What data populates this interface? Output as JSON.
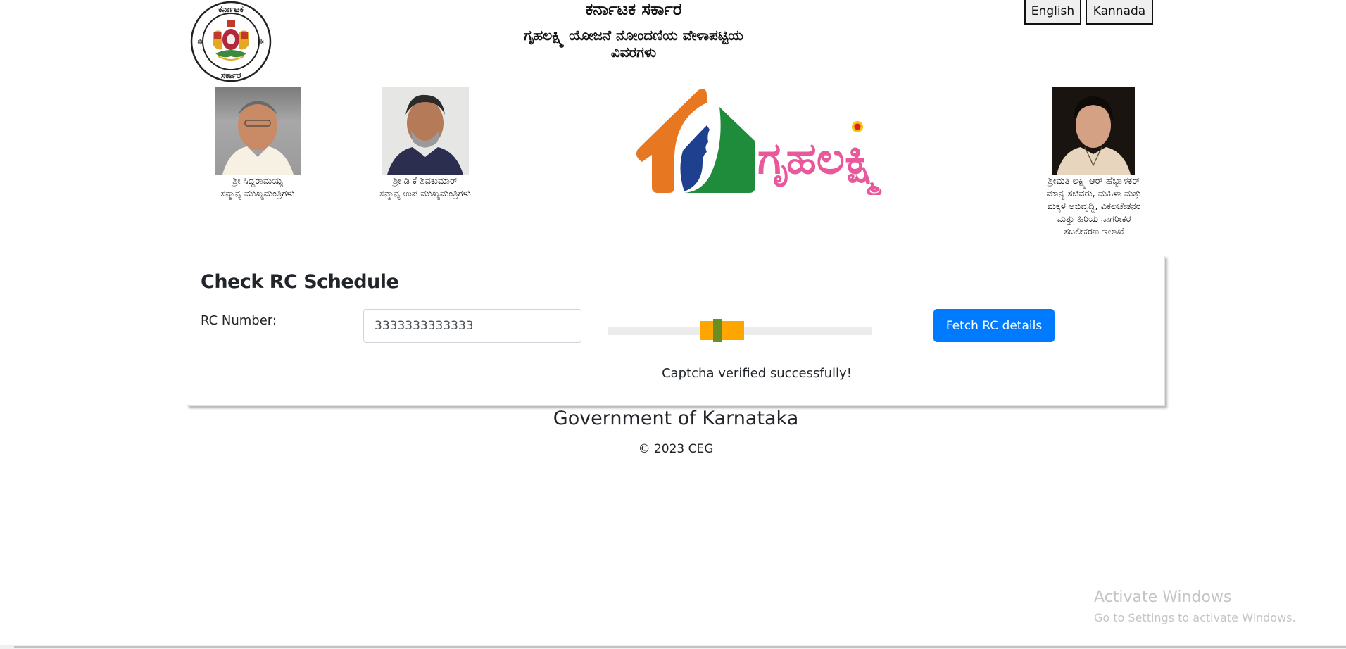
{
  "header": {
    "title": "ಕರ್ನಾಟಕ ಸರ್ಕಾರ",
    "subtitle_line1": "ಗೃಹಲಕ್ಷ್ಮಿ ಯೋಜನೆ ನೋಂದಣಿಯ ವೇಳಾಪಟ್ಟಿಯ",
    "subtitle_line2": "ವಿವರಗಳು",
    "emblem_text_top": "ಕರ್ನಾಟಕ",
    "emblem_text_bottom": "ಸರ್ಕಾರ",
    "language_buttons": [
      "English",
      "Kannada"
    ]
  },
  "leaders": [
    {
      "name": "ಶ್ರೀ ಸಿದ್ದರಾಮಯ್ಯ",
      "title_lines": [
        "ಸನ್ಮಾನ್ಯ ಮುಖ್ಯಮಂತ್ರಿಗಳು"
      ]
    },
    {
      "name": "ಶ್ರೀ ಡಿ ಕೆ ಶಿವಕುಮಾರ್",
      "title_lines": [
        "ಸನ್ಮಾನ್ಯ ಉಪ ಮುಖ್ಯಮಂತ್ರಿಗಳು"
      ]
    },
    {
      "name": "ಶ್ರೀಮತಿ ಲಕ್ಷ್ಮಿ ಆರ್ ಹೆಬ್ಬಾಳಕರ್",
      "title_lines": [
        "ಮಾನ್ಯ ಸಚಿವರು, ಮಹಿಳಾ ಮತ್ತು",
        "ಮಕ್ಕಳ ಅಭಿವೃದ್ಧಿ, ವಿಕಲಚೇತನರ",
        "ಮತ್ತು ಹಿರಿಯ ನಾಗರೀಕರ",
        "ಸಬಲೀಕರಣ ಇಲಾಖೆ"
      ]
    }
  ],
  "logo": {
    "text": "ಗೃಹಲಕ್ಷ್ಮಿ",
    "colors": {
      "orange": "#e87722",
      "green": "#1e8c3a",
      "blue": "#1f3f8f",
      "pink": "#e8589a",
      "dot": "#e31b23"
    }
  },
  "form": {
    "heading": "Check RC Schedule",
    "rc_label": "RC Number:",
    "rc_value": "3333333333333",
    "slider": {
      "thumb_position_fraction": 0.4,
      "target_color": "#ffa500",
      "thumb_color": "#6b8e23",
      "track_color": "#ececec"
    },
    "fetch_button": "Fetch RC details",
    "captcha_status": "Captcha verified successfully!",
    "accent": "#007bff"
  },
  "footer": {
    "title": "Government of Karnataka",
    "copyright": "© 2023 CEG"
  },
  "watermark": {
    "title": "Activate Windows",
    "subtitle": "Go to Settings to activate Windows."
  }
}
